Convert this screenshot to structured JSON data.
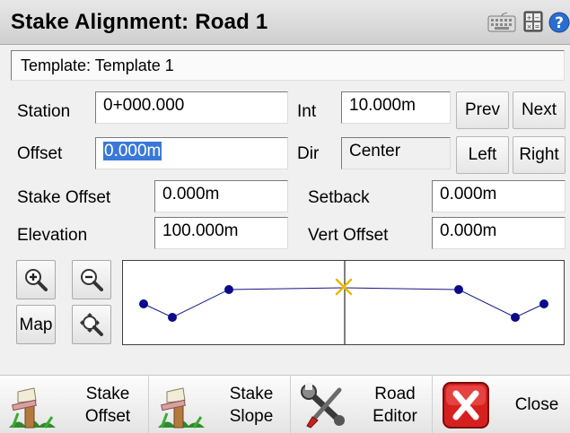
{
  "title": "Stake Alignment: Road 1",
  "toolbar_icons": [
    "keyboard-icon",
    "calculator-icon",
    "help-icon"
  ],
  "template": {
    "text": "Template: Template 1"
  },
  "station": {
    "label": "Station",
    "value": "0+000.000"
  },
  "interval": {
    "label": "Int",
    "value": "10.000m"
  },
  "prev_label": "Prev",
  "next_label": "Next",
  "offset": {
    "label": "Offset",
    "value": "0.000m"
  },
  "direction": {
    "label": "Dir",
    "value": "Center"
  },
  "left_label": "Left",
  "right_label": "Right",
  "stake_offset": {
    "label": "Stake Offset",
    "value": "0.000m"
  },
  "setback": {
    "label": "Setback",
    "value": "0.000m"
  },
  "elevation": {
    "label": "Elevation",
    "value": "100.000m"
  },
  "vert_offset": {
    "label": "Vert Offset",
    "value": "0.000m"
  },
  "map_label": "Map",
  "view_tools": [
    "zoom-in-icon",
    "zoom-out-icon",
    "zoom-extents-icon"
  ],
  "colors": {
    "accent": "#3a78d8",
    "node": "#0a0a8a",
    "marker": "#e8b800",
    "close_red": "#d62020"
  },
  "bottom": {
    "stake_offset": [
      "Stake",
      "Offset"
    ],
    "stake_slope": [
      "Stake",
      "Slope"
    ],
    "road_editor": [
      "Road",
      "Editor"
    ],
    "close": "Close"
  }
}
